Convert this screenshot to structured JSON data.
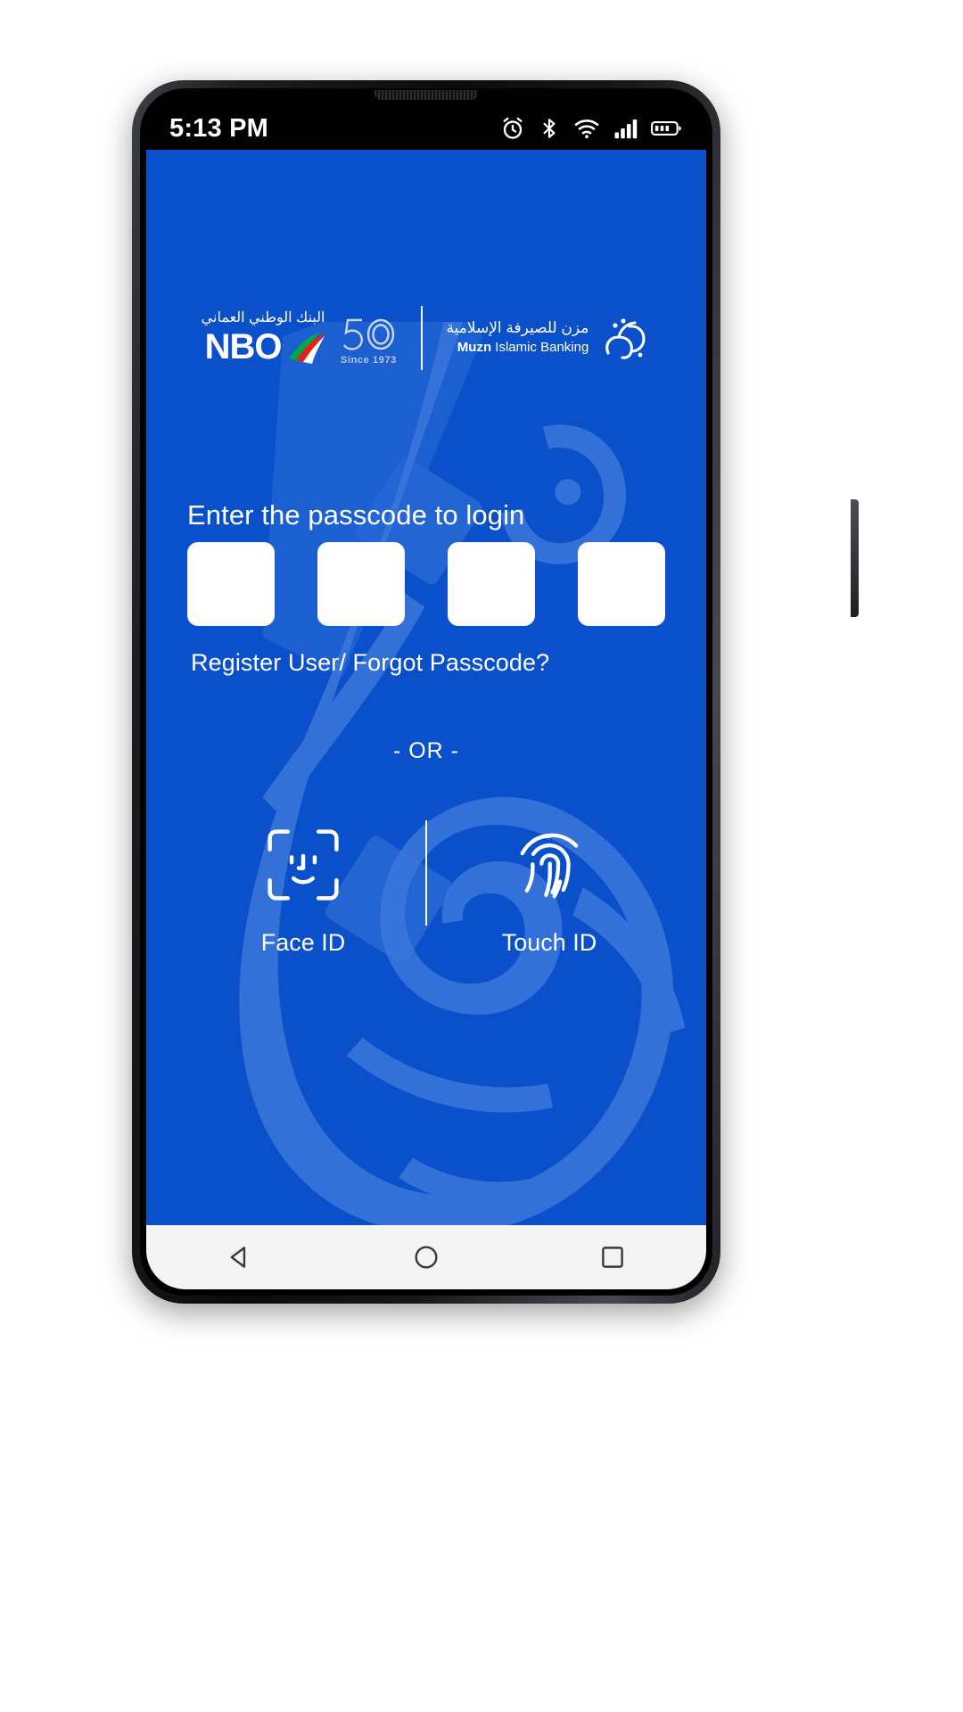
{
  "status_bar": {
    "time": "5:13 PM",
    "icons": [
      "alarm-icon",
      "bluetooth-icon",
      "wifi-icon",
      "cellular-signal-icon",
      "battery-icon"
    ]
  },
  "brand": {
    "nbo": {
      "arabic": "البنك الوطني العماني",
      "name": "NBO",
      "anniversary": "50",
      "since": "Since 1973",
      "swoosh_colors": [
        "#E2231A",
        "#00A651",
        "#FFFFFF"
      ]
    },
    "muzn": {
      "arabic": "مزن للصيرفة الإسلامية",
      "english_bold": "Muzn",
      "english": " Islamic Banking"
    }
  },
  "login": {
    "title": "Enter the passcode to login",
    "passcode_digits": [
      "",
      "",
      "",
      ""
    ],
    "passcode_placeholder": "",
    "register_link": "Register User/ Forgot Passcode?",
    "or_separator": "- OR -",
    "biometrics": [
      {
        "label": "Face ID",
        "icon": "face-id-icon"
      },
      {
        "label": "Touch ID",
        "icon": "fingerprint-icon"
      }
    ]
  },
  "nav_bar": {
    "back": "back-triangle-icon",
    "home": "home-circle-icon",
    "recents": "recents-square-icon"
  },
  "colors": {
    "brand_blue": "#0B50CB",
    "watermark_blue": "#3B77DC",
    "status_bar_bg": "#000000",
    "nav_bar_bg": "#F4F4F4",
    "box_fill": "#FFFFFF",
    "text_on_blue": "#FFFFFF",
    "since_text": "#B9C8DD"
  }
}
